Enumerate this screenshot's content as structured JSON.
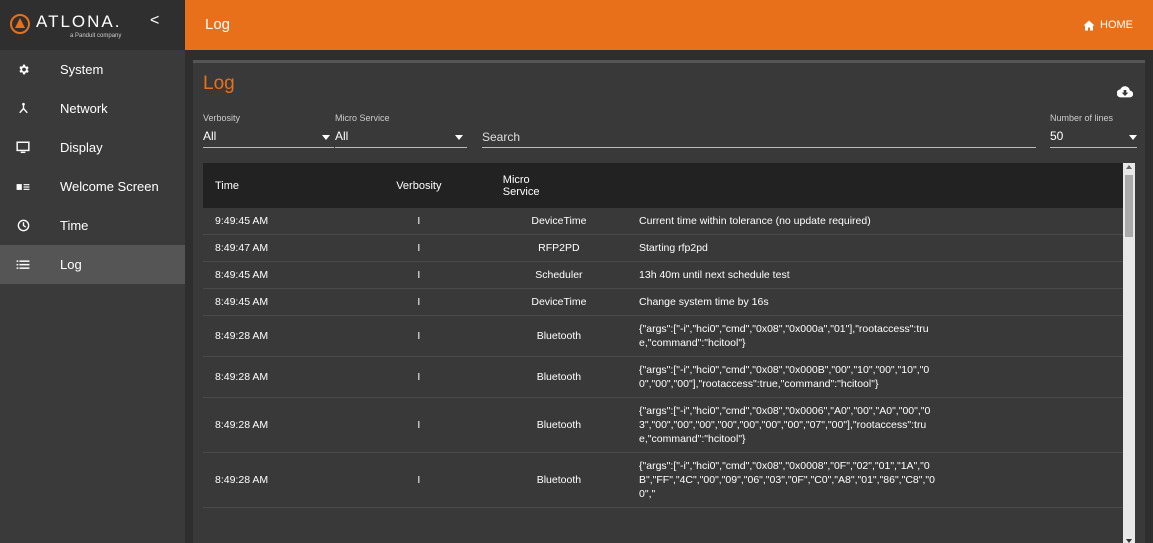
{
  "brand": {
    "name": "ATLONA.",
    "sub": "a Panduit company",
    "collapse": "<"
  },
  "sidebar": {
    "items": [
      {
        "label": "System",
        "icon": "gear-icon",
        "active": false
      },
      {
        "label": "Network",
        "icon": "network-icon",
        "active": false
      },
      {
        "label": "Display",
        "icon": "display-icon",
        "active": false
      },
      {
        "label": "Welcome Screen",
        "icon": "welcome-screen-icon",
        "active": false
      },
      {
        "label": "Time",
        "icon": "clock-icon",
        "active": false
      },
      {
        "label": "Log",
        "icon": "list-icon",
        "active": true
      }
    ]
  },
  "topbar": {
    "title": "Log",
    "home_label": "HOME"
  },
  "panel": {
    "title": "Log"
  },
  "filters": {
    "verbosity_label": "Verbosity",
    "verbosity_value": "All",
    "microservice_label": "Micro Service",
    "microservice_value": "All",
    "search_placeholder": "Search",
    "lines_label": "Number of lines",
    "lines_value": "50"
  },
  "table": {
    "headers": {
      "time": "Time",
      "verbosity": "Verbosity",
      "service_line1": "Micro",
      "service_line2": "Service",
      "message": ""
    },
    "rows": [
      {
        "time": "9:49:45 AM",
        "verbosity": "I",
        "service": "DeviceTime",
        "message": "Current time within tolerance (no update required)"
      },
      {
        "time": "8:49:47 AM",
        "verbosity": "I",
        "service": "RFP2PD",
        "message": "Starting rfp2pd"
      },
      {
        "time": "8:49:45 AM",
        "verbosity": "I",
        "service": "Scheduler",
        "message": "13h 40m until next schedule test"
      },
      {
        "time": "8:49:45 AM",
        "verbosity": "I",
        "service": "DeviceTime",
        "message": "Change system time by 16s"
      },
      {
        "time": "8:49:28 AM",
        "verbosity": "I",
        "service": "Bluetooth",
        "message": "{\"args\":[\"-i\",\"hci0\",\"cmd\",\"0x08\",\"0x000a\",\"01\"],\"rootaccess\":true,\"command\":\"hcitool\"}"
      },
      {
        "time": "8:49:28 AM",
        "verbosity": "I",
        "service": "Bluetooth",
        "message": "{\"args\":[\"-i\",\"hci0\",\"cmd\",\"0x08\",\"0x000B\",\"00\",\"10\",\"00\",\"10\",\"00\",\"00\",\"00\"],\"rootaccess\":true,\"command\":\"hcitool\"}"
      },
      {
        "time": "8:49:28 AM",
        "verbosity": "I",
        "service": "Bluetooth",
        "message": "{\"args\":[\"-i\",\"hci0\",\"cmd\",\"0x08\",\"0x0006\",\"A0\",\"00\",\"A0\",\"00\",\"03\",\"00\",\"00\",\"00\",\"00\",\"00\",\"00\",\"00\",\"07\",\"00\"],\"rootaccess\":true,\"command\":\"hcitool\"}"
      },
      {
        "time": "8:49:28 AM",
        "verbosity": "I",
        "service": "Bluetooth",
        "message": "{\"args\":[\"-i\",\"hci0\",\"cmd\",\"0x08\",\"0x0008\",\"0F\",\"02\",\"01\",\"1A\",\"0B\",\"FF\",\"4C\",\"00\",\"09\",\"06\",\"03\",\"0F\",\"C0\",\"A8\",\"01\",\"86\",\"C8\",\"00\",\""
      }
    ]
  },
  "colors": {
    "accent": "#e8701a",
    "sidebar": "#3a3a3a",
    "panel": "#393939"
  }
}
